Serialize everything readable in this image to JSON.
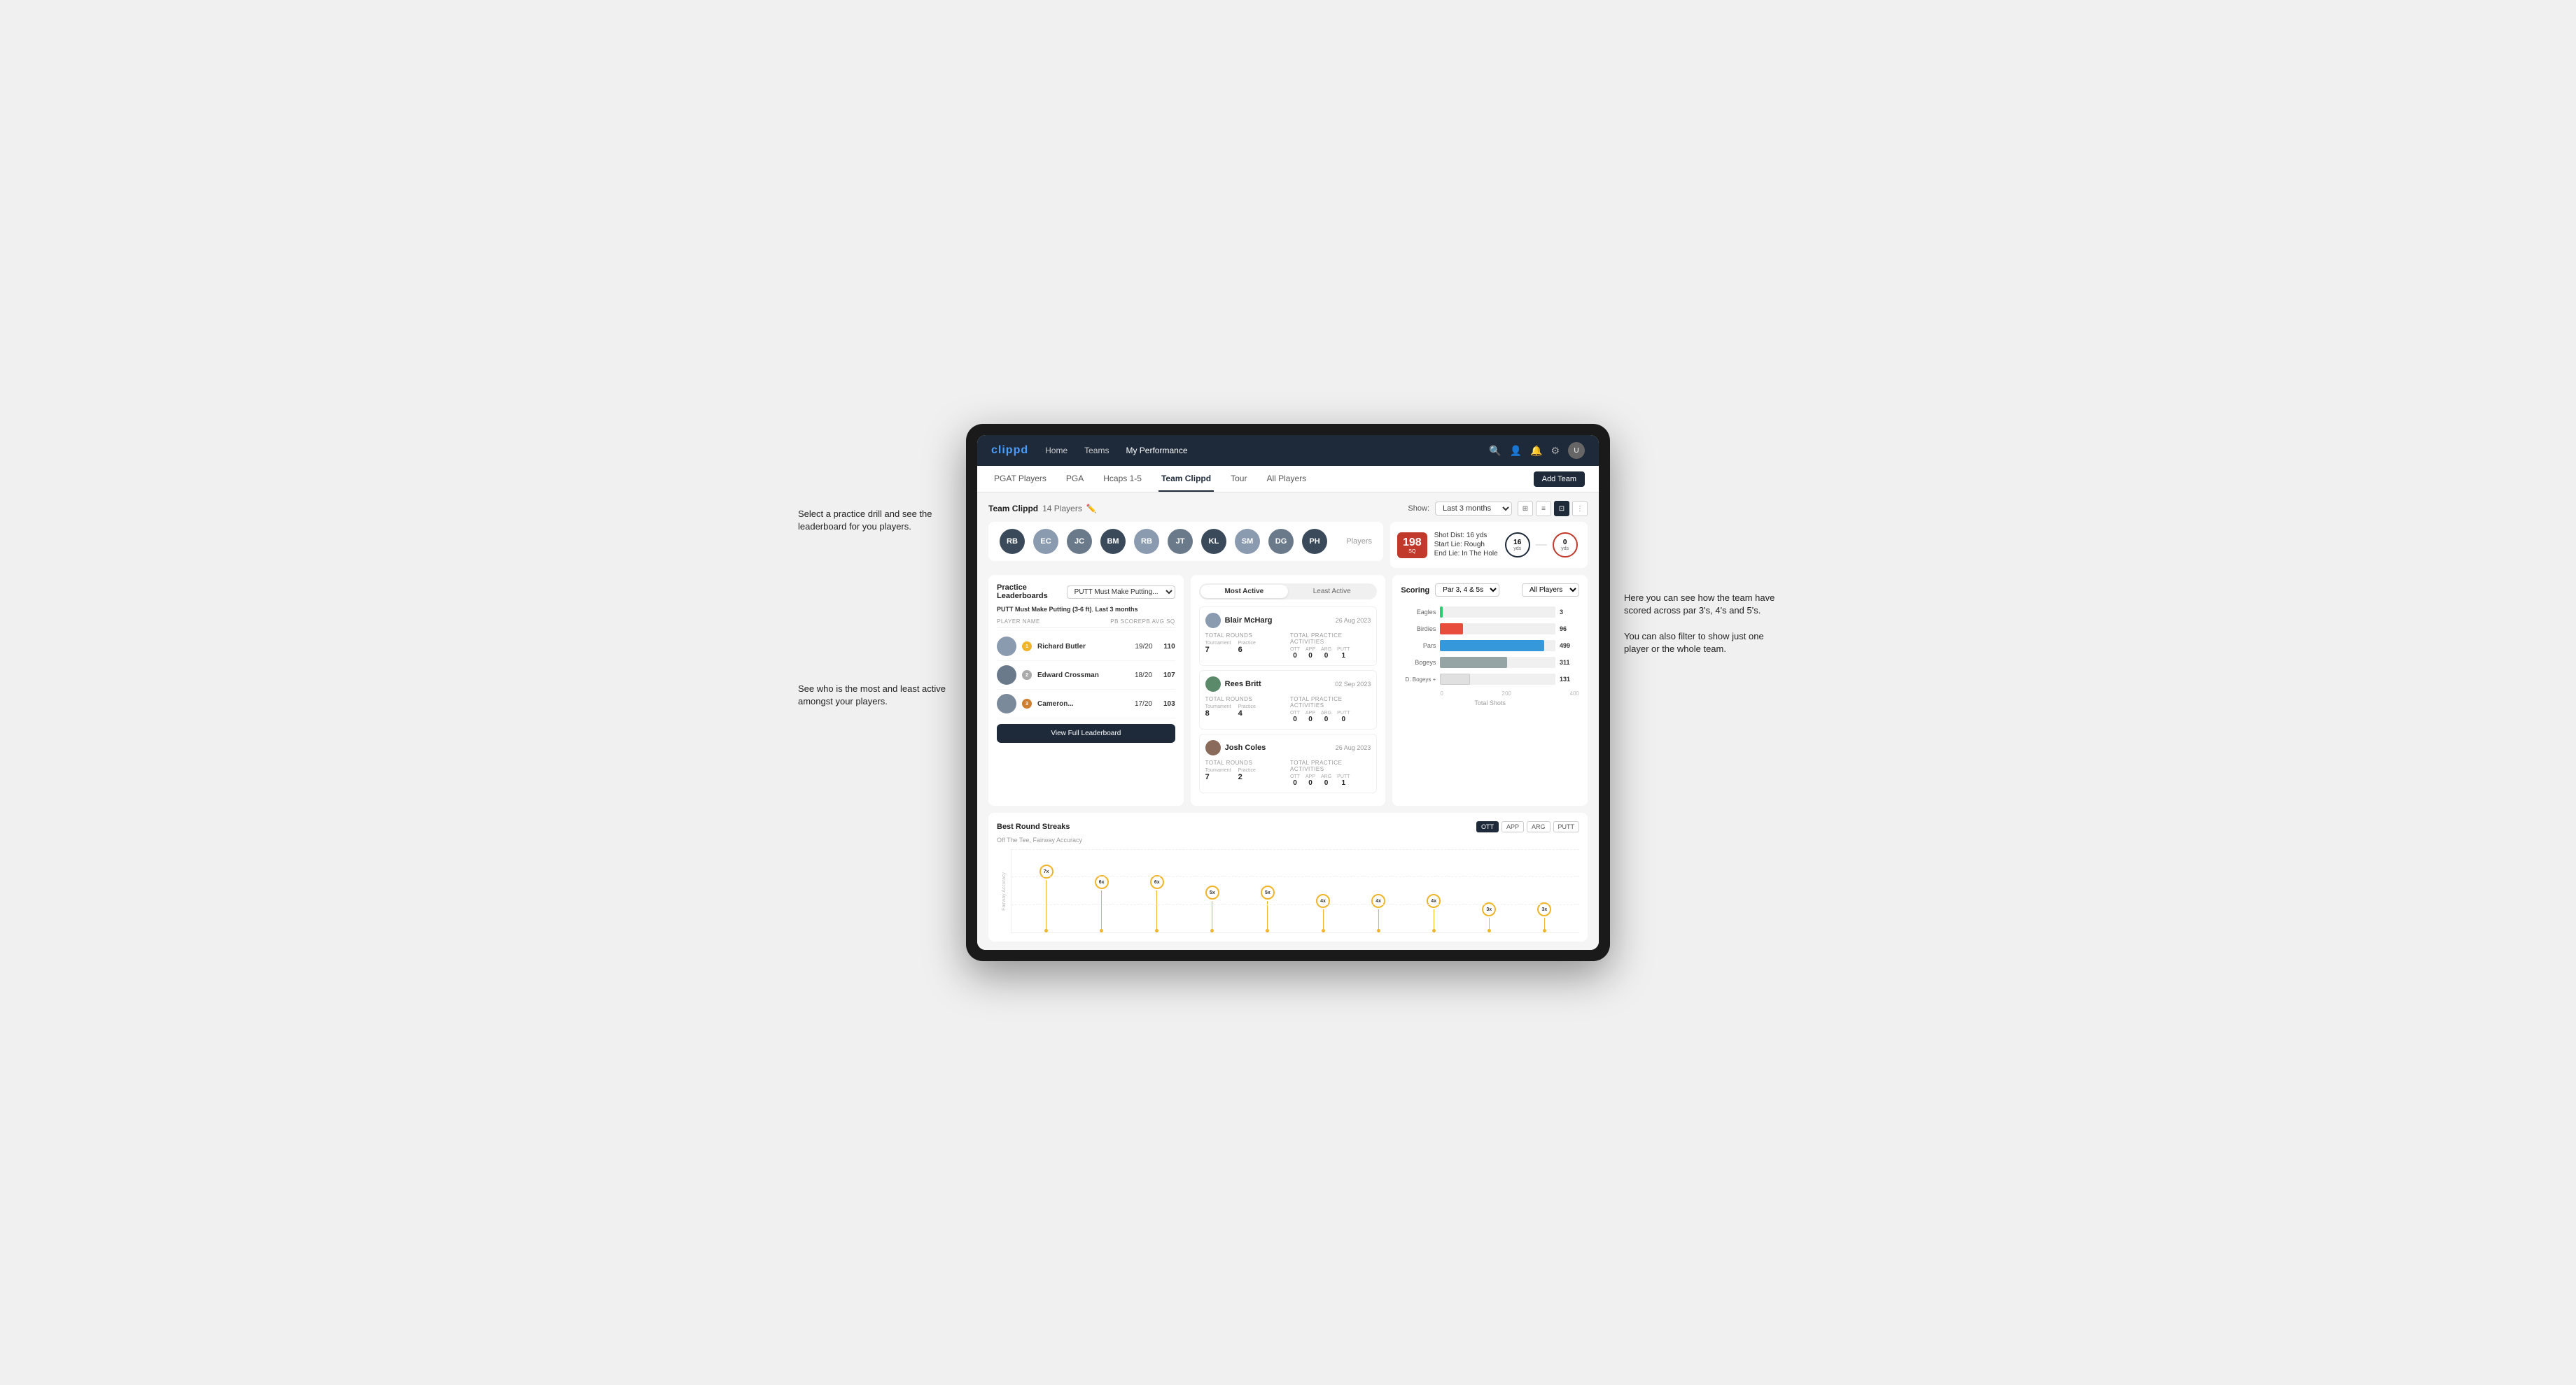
{
  "annotations": {
    "left1": "Select a practice drill and see the leaderboard for you players.",
    "left2": "See who is the most and least active amongst your players.",
    "right1": "Here you can see how the team have scored across par 3's, 4's and 5's.\n\nYou can also filter to show just one player or the whole team."
  },
  "navbar": {
    "brand": "clippd",
    "links": [
      "Home",
      "Teams",
      "My Performance"
    ],
    "icons": [
      "🔍",
      "👤",
      "🔔",
      "⚙"
    ]
  },
  "subnav": {
    "links": [
      "PGAT Players",
      "PGA",
      "Hcaps 1-5",
      "Team Clippd",
      "Tour",
      "All Players"
    ],
    "active": "Team Clippd",
    "add_button": "Add Team"
  },
  "team": {
    "title": "Team Clippd",
    "player_count": "14 Players",
    "show_label": "Show:",
    "show_value": "Last 3 months"
  },
  "shot_card": {
    "badge": "198",
    "badge_sub": "SQ",
    "detail1": "Shot Dist: 16 yds",
    "detail2": "Start Lie: Rough",
    "detail3": "End Lie: In The Hole",
    "yds1": "16",
    "yds1_sub": "yds",
    "yds2": "0",
    "yds2_sub": "yds"
  },
  "practice_leaderboard": {
    "title": "Practice Leaderboards",
    "dropdown": "PUTT Must Make Putting...",
    "subtitle_drill": "PUTT Must Make Putting (3-6 ft)",
    "subtitle_period": "Last 3 months",
    "col_player": "PLAYER NAME",
    "col_score": "PB SCORE",
    "col_avg": "PB AVG SQ",
    "players": [
      {
        "name": "Richard Butler",
        "badge": "1",
        "badge_type": "gold",
        "score": "19/20",
        "avg": "110"
      },
      {
        "name": "Edward Crossman",
        "badge": "2",
        "badge_type": "silver",
        "score": "18/20",
        "avg": "107"
      },
      {
        "name": "Cameron...",
        "badge": "3",
        "badge_type": "bronze",
        "score": "17/20",
        "avg": "103"
      }
    ],
    "view_full_btn": "View Full Leaderboard"
  },
  "activity": {
    "tab_active": "Most Active",
    "tab_inactive": "Least Active",
    "players": [
      {
        "name": "Blair McHarg",
        "date": "26 Aug 2023",
        "total_rounds_label": "Total Rounds",
        "tournament_label": "Tournament",
        "practice_label": "Practice",
        "tournament_val": "7",
        "practice_val": "6",
        "total_practice_label": "Total Practice Activities",
        "ott_label": "OTT",
        "app_label": "APP",
        "arg_label": "ARG",
        "putt_label": "PUTT",
        "ott_val": "0",
        "app_val": "0",
        "arg_val": "0",
        "putt_val": "1"
      },
      {
        "name": "Rees Britt",
        "date": "02 Sep 2023",
        "total_rounds_label": "Total Rounds",
        "tournament_label": "Tournament",
        "practice_label": "Practice",
        "tournament_val": "8",
        "practice_val": "4",
        "total_practice_label": "Total Practice Activities",
        "ott_label": "OTT",
        "app_label": "APP",
        "arg_label": "ARG",
        "putt_label": "PUTT",
        "ott_val": "0",
        "app_val": "0",
        "arg_val": "0",
        "putt_val": "0"
      },
      {
        "name": "Josh Coles",
        "date": "26 Aug 2023",
        "total_rounds_label": "Total Rounds",
        "tournament_label": "Tournament",
        "practice_label": "Practice",
        "tournament_val": "7",
        "practice_val": "2",
        "total_practice_label": "Total Practice Activities",
        "ott_label": "OTT",
        "app_label": "APP",
        "arg_label": "ARG",
        "putt_label": "PUTT",
        "ott_val": "0",
        "app_val": "0",
        "arg_val": "0",
        "putt_val": "1"
      }
    ]
  },
  "scoring": {
    "title": "Scoring",
    "filter1": "Par 3, 4 & 5s",
    "filter2": "All Players",
    "bars": [
      {
        "label": "Eagles",
        "val": "3",
        "pct": 2,
        "type": "eagles"
      },
      {
        "label": "Birdies",
        "val": "96",
        "pct": 18,
        "type": "birdies"
      },
      {
        "label": "Pars",
        "val": "499",
        "pct": 90,
        "type": "pars"
      },
      {
        "label": "Bogeys",
        "val": "311",
        "pct": 56,
        "type": "bogeys"
      },
      {
        "label": "D. Bogeys +",
        "val": "131",
        "pct": 25,
        "type": "dbogeys"
      }
    ],
    "axis_labels": [
      "0",
      "200",
      "400"
    ],
    "axis_bottom": "Total Shots"
  },
  "streaks": {
    "title": "Best Round Streaks",
    "buttons": [
      "OTT",
      "APP",
      "ARG",
      "PUTT"
    ],
    "active_btn": "OTT",
    "subtitle": "Off The Tee, Fairway Accuracy",
    "y_label": "Fairway Accuracy",
    "bubbles": [
      {
        "label": "7x",
        "height": 90
      },
      {
        "label": "6x",
        "height": 72
      },
      {
        "label": "6x",
        "height": 72
      },
      {
        "label": "5x",
        "height": 55
      },
      {
        "label": "5x",
        "height": 55
      },
      {
        "label": "4x",
        "height": 38
      },
      {
        "label": "4x",
        "height": 38
      },
      {
        "label": "4x",
        "height": 38
      },
      {
        "label": "3x",
        "height": 20
      },
      {
        "label": "3x",
        "height": 20
      }
    ]
  }
}
